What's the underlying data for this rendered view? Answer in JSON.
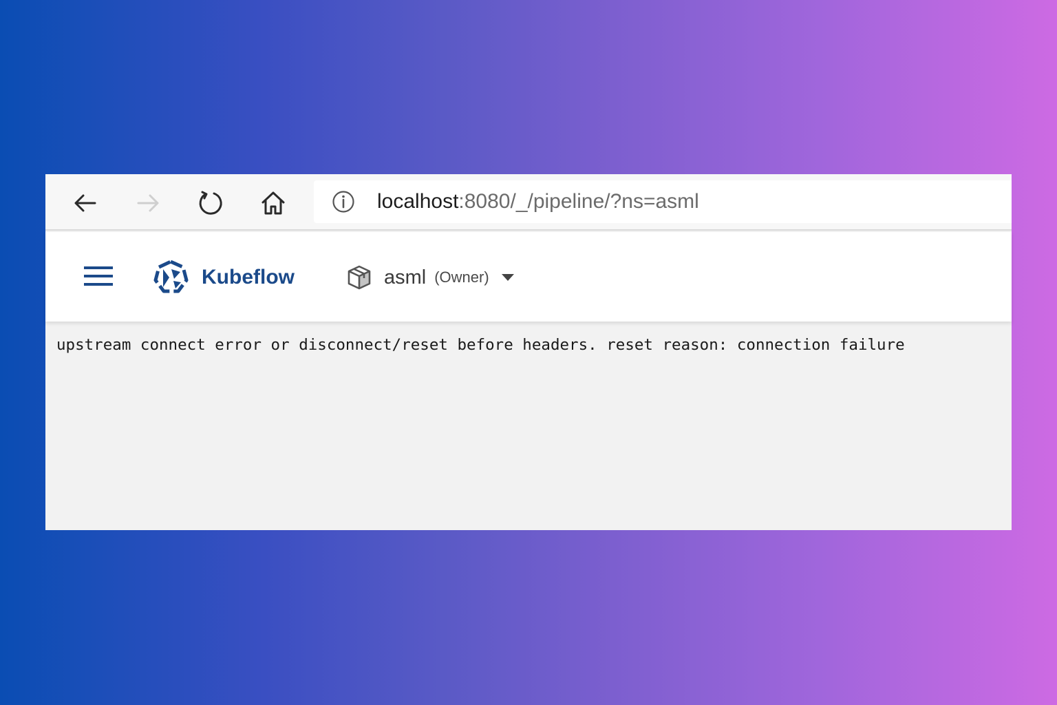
{
  "browser": {
    "url_host": "localhost",
    "url_rest": ":8080/_/pipeline/?ns=asml",
    "nav_icons": [
      "back-arrow-icon",
      "forward-arrow-icon",
      "refresh-icon",
      "home-icon",
      "info-icon"
    ]
  },
  "app": {
    "brand": "Kubeflow",
    "namespace": {
      "name": "asml",
      "role": "(Owner)"
    },
    "icons": [
      "menu-icon",
      "kubeflow-logo-icon",
      "namespace-box-icon",
      "caret-down-icon"
    ]
  },
  "content": {
    "error_message": "upstream connect error or disconnect/reset before headers. reset reason: connection failure"
  },
  "colors": {
    "brand": "#1b4a8a",
    "background_gradient_start": "#0a4db3",
    "background_gradient_end": "#cd6ae3",
    "content_background": "#f2f2f2"
  }
}
